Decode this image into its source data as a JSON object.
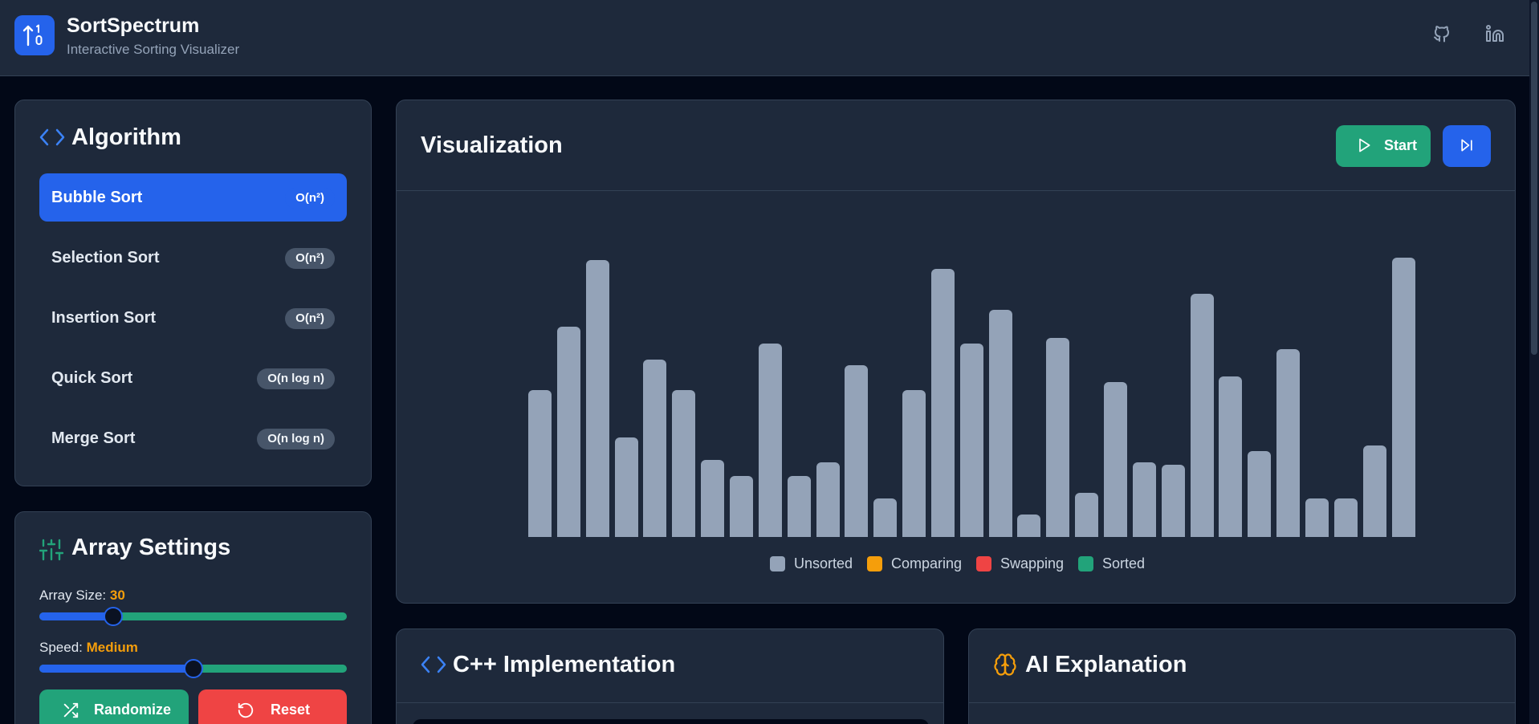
{
  "header": {
    "title": "SortSpectrum",
    "subtitle": "Interactive Sorting Visualizer",
    "icons": [
      "github-icon",
      "linkedin-icon"
    ]
  },
  "algorithm_panel": {
    "title": "Algorithm",
    "items": [
      {
        "label": "Bubble Sort",
        "complexity": "O(n²)",
        "active": true
      },
      {
        "label": "Selection Sort",
        "complexity": "O(n²)",
        "active": false
      },
      {
        "label": "Insertion Sort",
        "complexity": "O(n²)",
        "active": false
      },
      {
        "label": "Quick Sort",
        "complexity": "O(n log n)",
        "active": false
      },
      {
        "label": "Merge Sort",
        "complexity": "O(n log n)",
        "active": false
      }
    ]
  },
  "array_settings": {
    "title": "Array Settings",
    "size_label": "Array Size:",
    "size_value": "30",
    "size_fraction": 0.24,
    "speed_label": "Speed:",
    "speed_value": "Medium",
    "speed_fraction": 0.5,
    "randomize_label": "Randomize",
    "reset_label": "Reset"
  },
  "visualization": {
    "title": "Visualization",
    "start_label": "Start",
    "values": [
      53,
      76,
      100,
      36,
      64,
      53,
      28,
      22,
      70,
      22,
      27,
      62,
      14,
      53,
      97,
      70,
      82,
      8,
      72,
      16,
      56,
      27,
      26,
      88,
      58,
      31,
      68,
      14,
      14,
      33,
      101
    ],
    "max_value": 101,
    "legend": [
      {
        "label": "Unsorted",
        "color": "#94a3b8"
      },
      {
        "label": "Comparing",
        "color": "#f59e0b"
      },
      {
        "label": "Swapping",
        "color": "#ef4444"
      },
      {
        "label": "Sorted",
        "color": "#22a37a"
      }
    ]
  },
  "code_panel": {
    "title": "C++ Implementation"
  },
  "ai_panel": {
    "title": "AI Explanation"
  },
  "colors": {
    "accent": "#2563eb",
    "success": "#22a37a",
    "danger": "#ef4444",
    "warning": "#f59e0b"
  }
}
